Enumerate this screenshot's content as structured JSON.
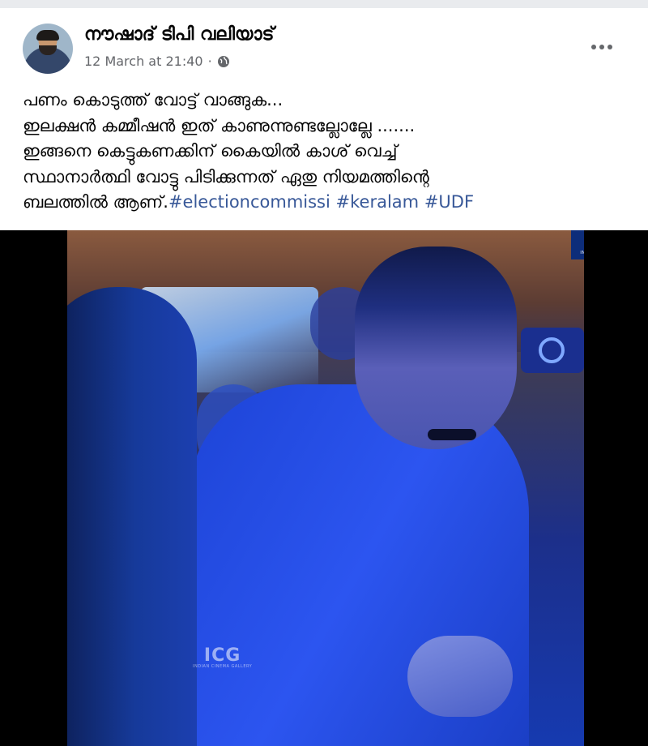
{
  "post": {
    "author": "നൗഷാദ് ടിപി വലിയാട്",
    "timestamp": "12 March at 21:40",
    "separator": "·",
    "audience_icon": "globe-icon",
    "more_icon": "more-options-icon",
    "text_lines": [
      "പണം കൊടുത്ത് വോട്ട് വാങ്ങുക...",
      "ഇലക്ഷൻ കമ്മീഷൻ ഇത് കാണുന്നുണ്ടല്ലോല്ലേ .......",
      "ഇങ്ങനെ കെട്ടുകണക്കിന് കൈയിൽ കാശ് വെച്ച്",
      "സ്ഥാനാർത്ഥി വോട്ടു പിടിക്കുന്നത് ഏതു നിയമത്തിന്റെ",
      "ബലത്തിൽ ആണ്."
    ],
    "hashtags": [
      "#electioncommissi",
      "#keralam",
      "#UDF"
    ]
  },
  "media": {
    "watermark_logo": "ICG",
    "watermark_caption": "INDIAN CINEMA GALLERY"
  },
  "colors": {
    "hashtag": "#385898",
    "meta": "#65676b",
    "letterbox": "#000000"
  }
}
